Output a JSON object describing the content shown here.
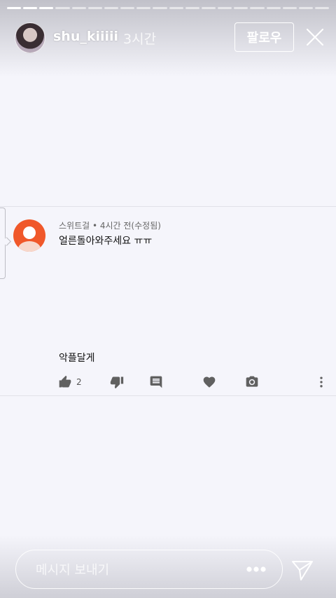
{
  "progress": {
    "segments_total": 20,
    "segments_done": 3
  },
  "header": {
    "username": "shu_kiiiii",
    "time": "3시간",
    "follow_label": "팔로우"
  },
  "comment": {
    "meta": "스위트걸 • 4시간 전(수정됨)",
    "text": "얼른돌아와주세요 ㅠㅠ",
    "text2": "악플달게",
    "like_count": "2",
    "avatar_color": "#f0582a"
  },
  "footer": {
    "message_placeholder": "메시지 보내기"
  },
  "icons": [
    "thumb-up-icon",
    "thumb-down-icon",
    "reply-icon",
    "heart-icon",
    "camera-icon",
    "more-vert-icon",
    "close-icon",
    "more-horiz-icon",
    "send-icon"
  ]
}
